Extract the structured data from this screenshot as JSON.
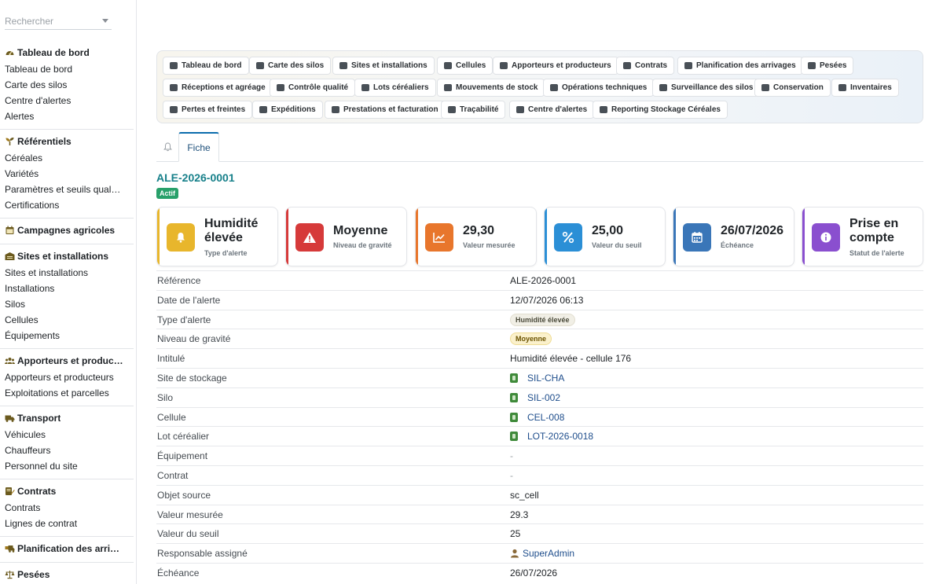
{
  "search": {
    "placeholder": "Rechercher"
  },
  "sidebar": {
    "sections": [
      {
        "title": "Tableau de bord",
        "icon": "gauge-icon",
        "items": [
          "Tableau de bord",
          "Carte des silos",
          "Centre d'alertes",
          "Alertes"
        ]
      },
      {
        "title": "Référentiels",
        "icon": "seedling-icon",
        "items": [
          "Céréales",
          "Variétés",
          "Paramètres et seuils qual…",
          "Certifications"
        ]
      },
      {
        "title": "Campagnes agricoles",
        "icon": "calendar-icon",
        "items": []
      },
      {
        "title": "Sites et installations",
        "icon": "warehouse-icon",
        "items": [
          "Sites et installations",
          "Installations",
          "Silos",
          "Cellules",
          "Équipements"
        ]
      },
      {
        "title": "Apporteurs et produc…",
        "icon": "users-icon",
        "items": [
          "Apporteurs et producteurs",
          "Exploitations et parcelles"
        ]
      },
      {
        "title": "Transport",
        "icon": "truck-icon",
        "items": [
          "Véhicules",
          "Chauffeurs",
          "Personnel du site"
        ]
      },
      {
        "title": "Contrats",
        "icon": "contract-icon",
        "items": [
          "Contrats",
          "Lignes de contrat"
        ]
      },
      {
        "title": "Planification des arri…",
        "icon": "truck-loading-icon",
        "items": []
      },
      {
        "title": "Pesées",
        "icon": "scale-icon",
        "items": []
      }
    ]
  },
  "menu": [
    "Tableau de bord",
    "Carte des silos",
    "Sites et installations",
    "Cellules",
    "Apporteurs et producteurs",
    "Contrats",
    "Planification des arrivages",
    "Pesées",
    "Réceptions et agréage",
    "Contrôle qualité",
    "Lots céréaliers",
    "Mouvements de stock",
    "Opérations techniques",
    "Surveillance des silos",
    "Conservation",
    "Inventaires",
    "Pertes et freintes",
    "Expéditions",
    "Prestations et facturation",
    "Traçabilité",
    "Centre d'alertes",
    "Reporting Stockage Céréales"
  ],
  "tabs": {
    "fiche": "Fiche"
  },
  "record": {
    "title": "ALE-2026-0001",
    "status": "Actif"
  },
  "cards": [
    {
      "value": "Humidité élevée",
      "label": "Type d'alerte",
      "icon": "bell-icon",
      "color": "#e8b62c"
    },
    {
      "value": "Moyenne",
      "label": "Niveau de gravité",
      "icon": "warning-icon",
      "color": "#d63a3a"
    },
    {
      "value": "29,30",
      "label": "Valeur mesurée",
      "icon": "chart-line-icon",
      "color": "#e8762c"
    },
    {
      "value": "25,00",
      "label": "Valeur du seuil",
      "icon": "percent-icon",
      "color": "#2b8fd6"
    },
    {
      "value": "26/07/2026",
      "label": "Échéance",
      "icon": "calendar-icon",
      "color": "#3a76b8"
    },
    {
      "value": "Prise en compte",
      "label": "Statut de l'alerte",
      "icon": "info-icon",
      "color": "#8a4fcf"
    }
  ],
  "fields": [
    {
      "key": "Référence",
      "value": "ALE-2026-0001"
    },
    {
      "key": "Date de l'alerte",
      "value": "12/07/2026 06:13"
    },
    {
      "key": "Type d'alerte",
      "value": "Humidité élevée"
    },
    {
      "key": "Niveau de gravité",
      "value": "Moyenne"
    },
    {
      "key": "Intitulé",
      "value": "Humidité élevée - cellule 176"
    },
    {
      "key": "Site de stockage",
      "value": "SIL-CHA"
    },
    {
      "key": "Silo",
      "value": "SIL-002"
    },
    {
      "key": "Cellule",
      "value": "CEL-008"
    },
    {
      "key": "Lot céréalier",
      "value": "LOT-2026-0018"
    },
    {
      "key": "Équipement",
      "value": "-"
    },
    {
      "key": "Contrat",
      "value": "-"
    },
    {
      "key": "Objet source",
      "value": "sc_cell"
    },
    {
      "key": "Valeur mesurée",
      "value": "29.3"
    },
    {
      "key": "Valeur du seuil",
      "value": "25"
    },
    {
      "key": "Responsable assigné",
      "value": "SuperAdmin"
    },
    {
      "key": "Échéance",
      "value": "26/07/2026"
    }
  ]
}
